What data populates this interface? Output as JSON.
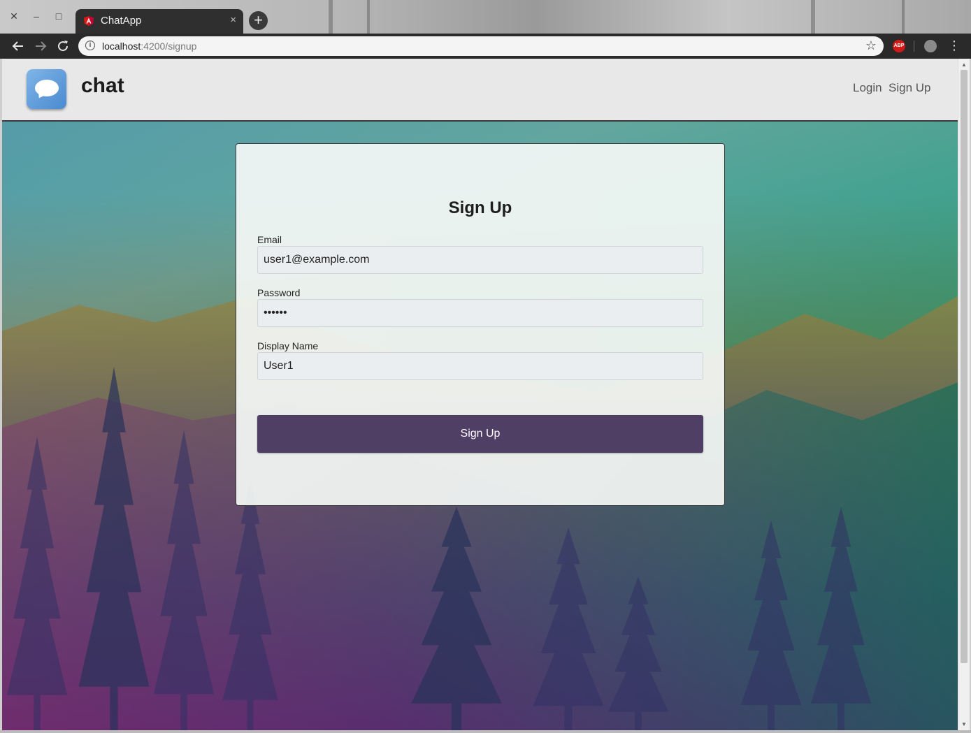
{
  "browser": {
    "tab_title": "ChatApp",
    "tab_close": "×",
    "new_tab": "+",
    "window_close": "✕",
    "window_minimize": "–",
    "window_maximize": "□",
    "url_host": "localhost",
    "url_path": ":4200/signup",
    "abp_label": "ABP"
  },
  "header": {
    "brand": "chat",
    "nav": {
      "login": "Login",
      "signup": "Sign Up"
    }
  },
  "form": {
    "title": "Sign Up",
    "email": {
      "label": "Email",
      "value": "user1@example.com"
    },
    "password": {
      "label": "Password",
      "value": "••••••"
    },
    "display_name": {
      "label": "Display Name",
      "value": "User1"
    },
    "submit_label": "Sign Up"
  },
  "colors": {
    "button": "#4f3f65",
    "header_bg": "#e8e8e8",
    "toolbar_bg": "#2a2a2a"
  }
}
